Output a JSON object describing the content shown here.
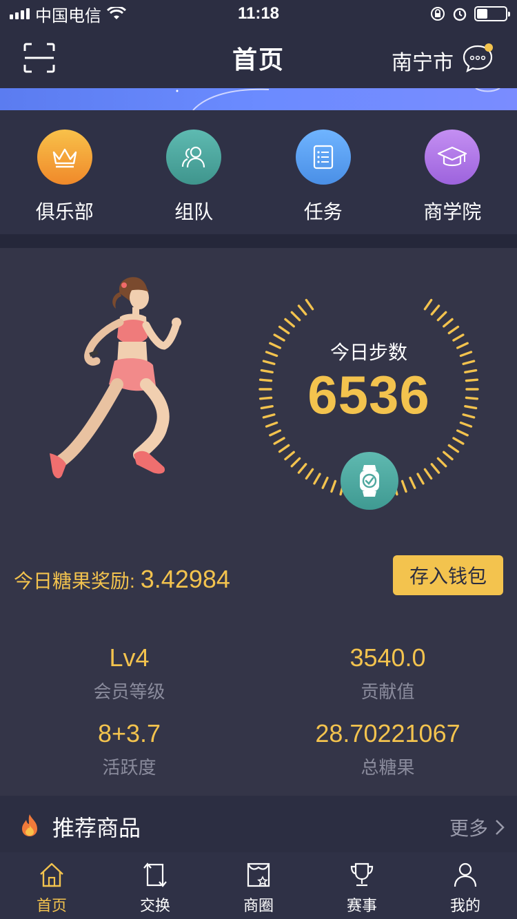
{
  "status_bar": {
    "carrier": "中国电信",
    "time": "11:18"
  },
  "header": {
    "title": "首页",
    "city": "南宁市"
  },
  "quick_nav": [
    {
      "label": "俱乐部",
      "icon": "crown-icon",
      "color": "#f4a63a"
    },
    {
      "label": "组队",
      "icon": "team-icon",
      "color": "#4fa89f"
    },
    {
      "label": "任务",
      "icon": "task-list-icon",
      "color": "#5ea2f0"
    },
    {
      "label": "商学院",
      "icon": "graduation-cap-icon",
      "color": "#b07ee8"
    }
  ],
  "steps": {
    "label": "今日步数",
    "value": "6536"
  },
  "reward": {
    "label": "今日糖果奖励:",
    "value": "3.42984",
    "deposit_label": "存入钱包"
  },
  "stats": [
    {
      "value": "Lv4",
      "label": "会员等级"
    },
    {
      "value": "3540.0",
      "label": "贡献值"
    },
    {
      "value": "8+3.7",
      "label": "活跃度"
    },
    {
      "value": "28.70221067",
      "label": "总糖果"
    }
  ],
  "recommended": {
    "title": "推荐商品",
    "more": "更多"
  },
  "tabs": [
    {
      "label": "首页",
      "icon": "home-icon",
      "active": true
    },
    {
      "label": "交换",
      "icon": "exchange-icon",
      "active": false
    },
    {
      "label": "商圈",
      "icon": "shop-icon",
      "active": false
    },
    {
      "label": "赛事",
      "icon": "trophy-icon",
      "active": false
    },
    {
      "label": "我的",
      "icon": "profile-icon",
      "active": false
    }
  ],
  "colors": {
    "accent": "#f3c34e",
    "background": "#2b2d40",
    "card": "#343548"
  }
}
